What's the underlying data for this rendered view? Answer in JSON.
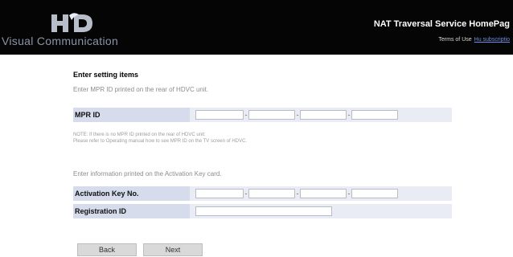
{
  "header": {
    "logo_text": "Visual Communication",
    "site_title": "NAT Traversal Service HomePag",
    "links": [
      "Terms of Use",
      "Hu subscriptio"
    ],
    "colors": {
      "bar": "#050505",
      "logo_text": "#8a95a8",
      "link": "#6f8fe8"
    }
  },
  "form": {
    "heading": "Enter setting items",
    "mpr_instruction": "Enter MPR ID printed on the rear of HDVC unit.",
    "mpr_label": "MPR ID",
    "mpr_fields": [
      "",
      "",
      "",
      ""
    ],
    "note_line1": "NOTE: If there is no MPR ID printed on the rear of HDVC unit:",
    "note_line2": "Please refer to Operating manual how to see MPR ID on the TV screen of HDVC.",
    "key_instruction": "Enter information printed on the Activation Key card.",
    "activation_label": "Activation Key No.",
    "activation_fields": [
      "",
      "",
      "",
      ""
    ],
    "registration_label": "Registration ID",
    "registration_value": ""
  },
  "buttons": {
    "back": "Back",
    "next": "Next"
  }
}
